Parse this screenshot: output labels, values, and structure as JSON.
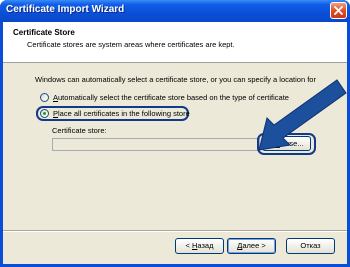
{
  "window": {
    "title": "Certificate Import Wizard"
  },
  "header": {
    "title": "Certificate Store",
    "subtitle": "Certificate stores are system areas where certificates are kept."
  },
  "body": {
    "intro": "Windows can automatically select a certificate store, or you can specify a location for",
    "options": [
      {
        "mnemonic": "A",
        "rest": "utomatically select the certificate store based on the type of certificate",
        "selected": false
      },
      {
        "mnemonic": "P",
        "rest": "lace all certificates in the following store",
        "selected": true
      }
    ],
    "store_label": "Certificate store:",
    "store_value": "",
    "browse_mnemonic": "R",
    "browse_pre": "B",
    "browse_rest": "owse..."
  },
  "footer": {
    "back_pre": "< ",
    "back_mnemonic": "Н",
    "back_rest": "азад",
    "next_mnemonic": "Д",
    "next_rest": "алее >",
    "cancel_label": "Отказ"
  },
  "colors": {
    "title_bar": "#0a4fd8",
    "highlight": "#123a8a",
    "radio_dot": "#21a121"
  }
}
